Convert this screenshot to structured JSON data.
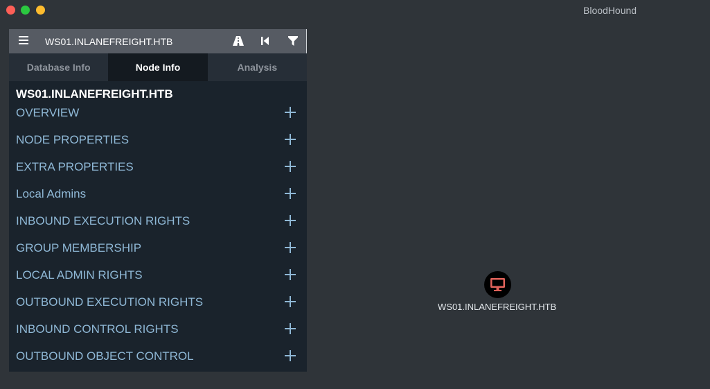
{
  "window": {
    "title": "BloodHound"
  },
  "search": {
    "value": "WS01.INLANEFREIGHT.HTB"
  },
  "toolbar": {
    "menu_icon": "hamburger-icon",
    "pathfinding_icon": "road-icon",
    "back_icon": "step-back-icon",
    "filter_icon": "filter-icon"
  },
  "tabs": [
    {
      "label": "Database Info",
      "active": false
    },
    {
      "label": "Node Info",
      "active": true
    },
    {
      "label": "Analysis",
      "active": false
    }
  ],
  "node_info": {
    "name": "WS01.INLANEFREIGHT.HTB",
    "sections": [
      {
        "label": "OVERVIEW"
      },
      {
        "label": "NODE PROPERTIES"
      },
      {
        "label": "EXTRA PROPERTIES"
      },
      {
        "label": "Local Admins"
      },
      {
        "label": "INBOUND EXECUTION RIGHTS"
      },
      {
        "label": "GROUP MEMBERSHIP"
      },
      {
        "label": "LOCAL ADMIN RIGHTS"
      },
      {
        "label": "OUTBOUND EXECUTION RIGHTS"
      },
      {
        "label": "INBOUND CONTROL RIGHTS"
      },
      {
        "label": "OUTBOUND OBJECT CONTROL"
      }
    ]
  },
  "graph": {
    "node": {
      "label": "WS01.INLANEFREIGHT.HTB",
      "icon": "computer-icon",
      "icon_color": "#e0625a"
    }
  },
  "colors": {
    "background": "#2f3439",
    "panel": "#1a232c",
    "section_text": "#8fb8d6",
    "close": "#fe5f57",
    "maximize": "#2bc840",
    "minimize": "#febc2e"
  }
}
